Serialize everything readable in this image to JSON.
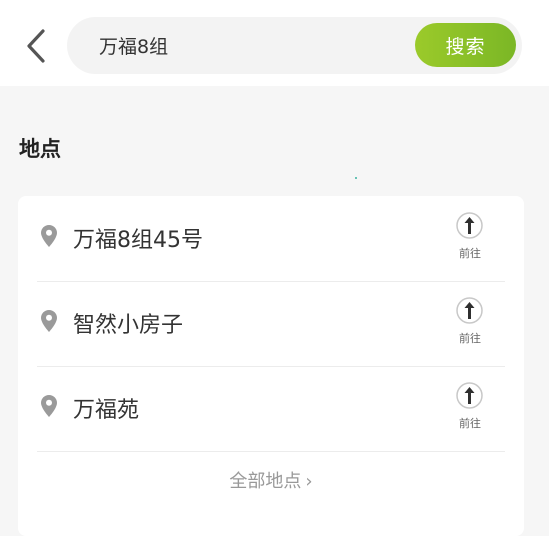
{
  "header": {
    "back_icon": "chevron-left-icon",
    "search": {
      "value": "万福8组",
      "button_label": "搜索"
    }
  },
  "section": {
    "title": "地点"
  },
  "places": [
    {
      "name": "万福8组45号",
      "action_label": "前往"
    },
    {
      "name": "智然小房子",
      "action_label": "前往"
    },
    {
      "name": "万福苑",
      "action_label": "前往"
    }
  ],
  "all_link": {
    "label": "全部地点",
    "chevron": "›"
  },
  "colors": {
    "accent_start": "#9bca2a",
    "accent_end": "#7bb726",
    "background": "#f6f6f6"
  }
}
